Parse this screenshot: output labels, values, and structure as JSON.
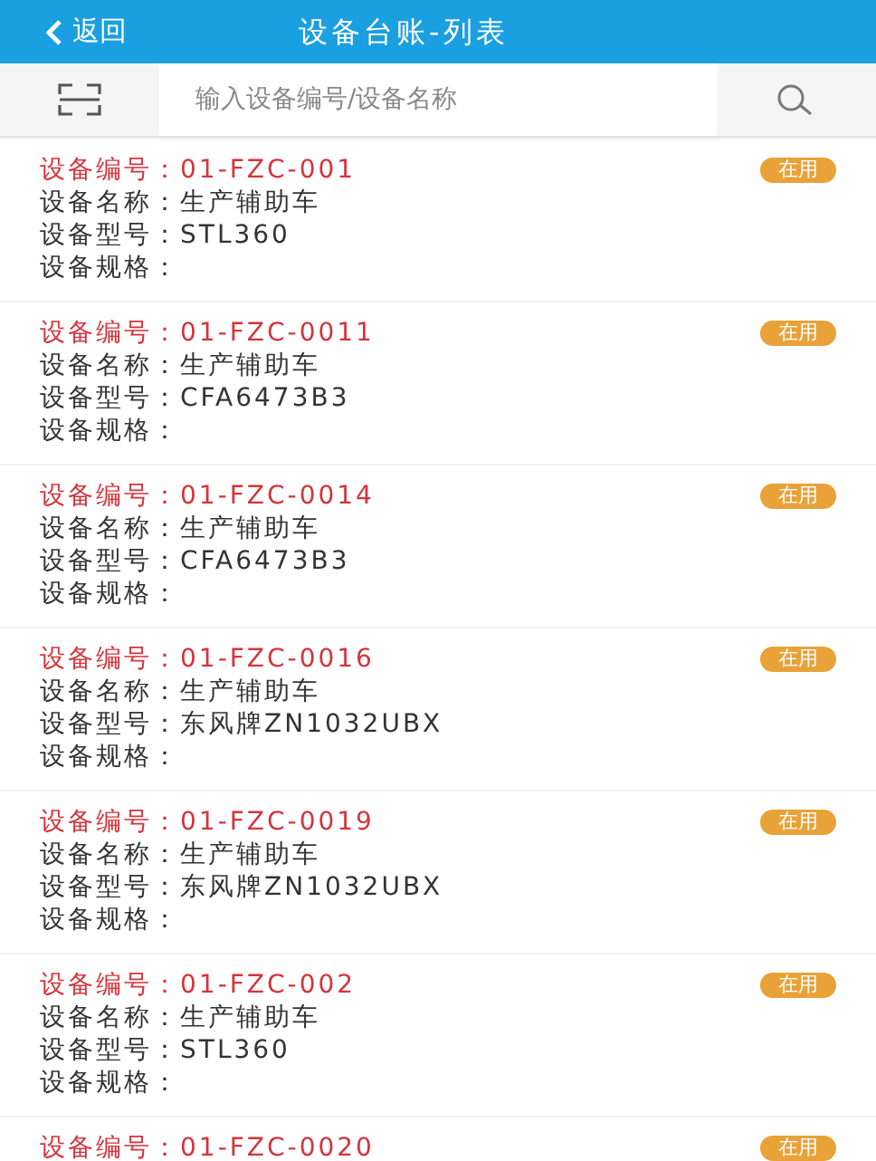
{
  "header": {
    "back": "返回",
    "title": "设备台账-列表"
  },
  "search": {
    "placeholder": "输入设备编号/设备名称"
  },
  "items": [
    {
      "status": "在用",
      "fields": [
        {
          "label": "设备编号：",
          "value": "01-FZC-001"
        },
        {
          "label": "设备名称：",
          "value": "生产辅助车"
        },
        {
          "label": "设备型号：",
          "value": "STL360"
        },
        {
          "label": "设备规格："
        }
      ]
    },
    {
      "status": "在用",
      "fields": [
        {
          "label": "设备编号：",
          "value": "01-FZC-0011"
        },
        {
          "label": "设备名称：",
          "value": "生产辅助车"
        },
        {
          "label": "设备型号：",
          "value": "CFA6473B3"
        },
        {
          "label": "设备规格："
        }
      ]
    },
    {
      "status": "在用",
      "fields": [
        {
          "label": "设备编号：",
          "value": "01-FZC-0014"
        },
        {
          "label": "设备名称：",
          "value": "生产辅助车"
        },
        {
          "label": "设备型号：",
          "value": "CFA6473B3"
        },
        {
          "label": "设备规格："
        }
      ]
    },
    {
      "status": "在用",
      "fields": [
        {
          "label": "设备编号：",
          "value": "01-FZC-0016"
        },
        {
          "label": "设备名称：",
          "value": "生产辅助车"
        },
        {
          "label": "设备型号：",
          "value": "东风牌ZN1032UBX"
        },
        {
          "label": "设备规格："
        }
      ]
    },
    {
      "status": "在用",
      "fields": [
        {
          "label": "设备编号：",
          "value": "01-FZC-0019"
        },
        {
          "label": "设备名称：",
          "value": "生产辅助车"
        },
        {
          "label": "设备型号：",
          "value": "东风牌ZN1032UBX"
        },
        {
          "label": "设备规格："
        }
      ]
    },
    {
      "status": "在用",
      "fields": [
        {
          "label": "设备编号：",
          "value": "01-FZC-002"
        },
        {
          "label": "设备名称：",
          "value": "生产辅助车"
        },
        {
          "label": "设备型号：",
          "value": "STL360"
        },
        {
          "label": "设备规格："
        }
      ]
    },
    {
      "status": "在用",
      "fields": [
        {
          "label": "设备编号：",
          "value": "01-FZC-0020"
        }
      ]
    }
  ]
}
